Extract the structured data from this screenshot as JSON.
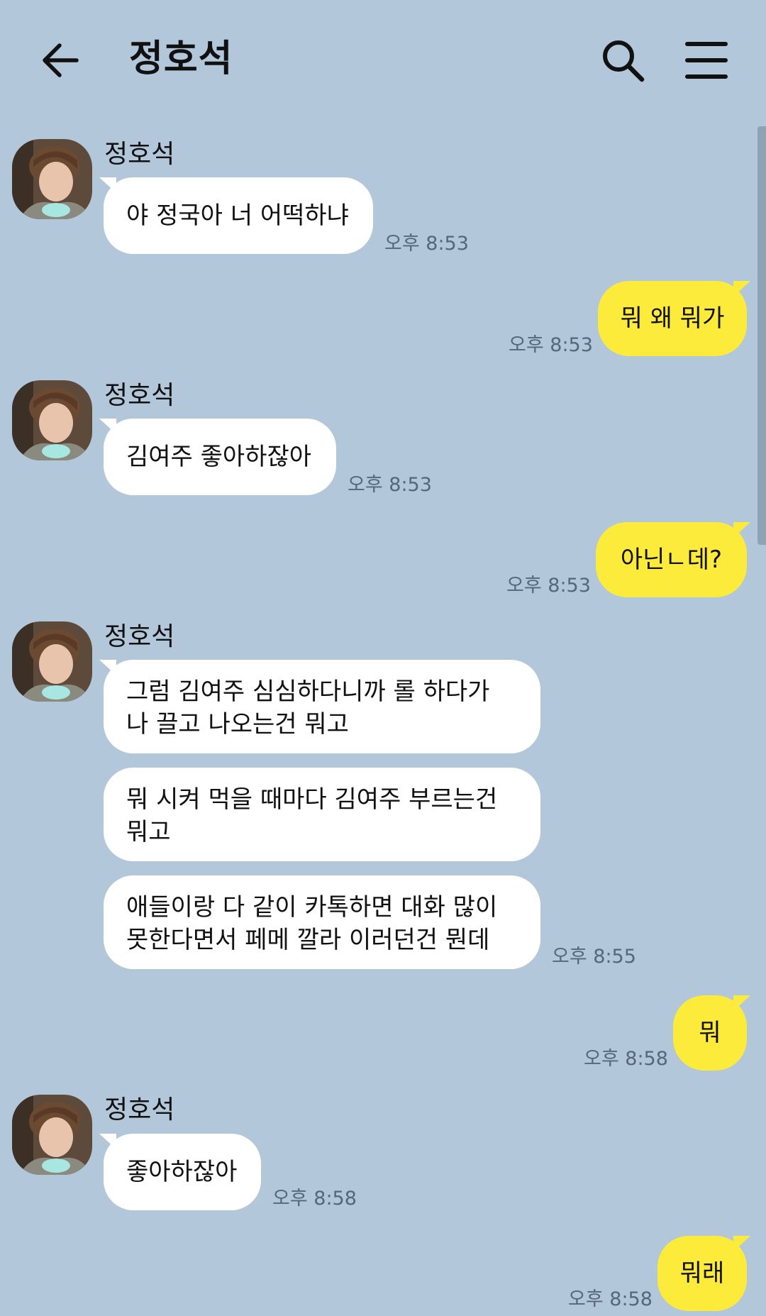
{
  "header": {
    "title": "정호석",
    "back_icon": "arrow-left-icon",
    "search_icon": "search-icon",
    "menu_icon": "hamburger-menu-icon"
  },
  "colors": {
    "background": "#b2c7da",
    "incoming_bubble": "#ffffff",
    "outgoing_bubble": "#fdeb3b"
  },
  "messages": [
    {
      "sender": "정호석",
      "text": "야 정국아 너 어떡하냐",
      "time": "오후 8:53"
    },
    {
      "text": "뭐 왜 뭐가",
      "time": "오후 8:53"
    },
    {
      "sender": "정호석",
      "text": "김여주 좋아하잖아",
      "time": "오후 8:53"
    },
    {
      "text": "아닌ㄴ데?",
      "time": "오후 8:53"
    },
    {
      "sender": "정호석",
      "texts": [
        [
          "그럼 김여주 심심하다니까 롤 하다가",
          "나 끌고 나오는건 뭐고"
        ],
        [
          "뭐 시켜 먹을 때마다 김여주 부르는건",
          "뭐고"
        ],
        [
          "애들이랑 다 같이 카톡하면 대화 많이",
          "못한다면서 페메 깔라 이러던건 뭔데"
        ]
      ],
      "time": "오후 8:55"
    },
    {
      "text": "뭐",
      "time": "오후 8:58"
    },
    {
      "sender": "정호석",
      "text": "좋아하잖아",
      "time": "오후 8:58"
    },
    {
      "text": "뭐래",
      "time": "오후 8:58"
    }
  ]
}
